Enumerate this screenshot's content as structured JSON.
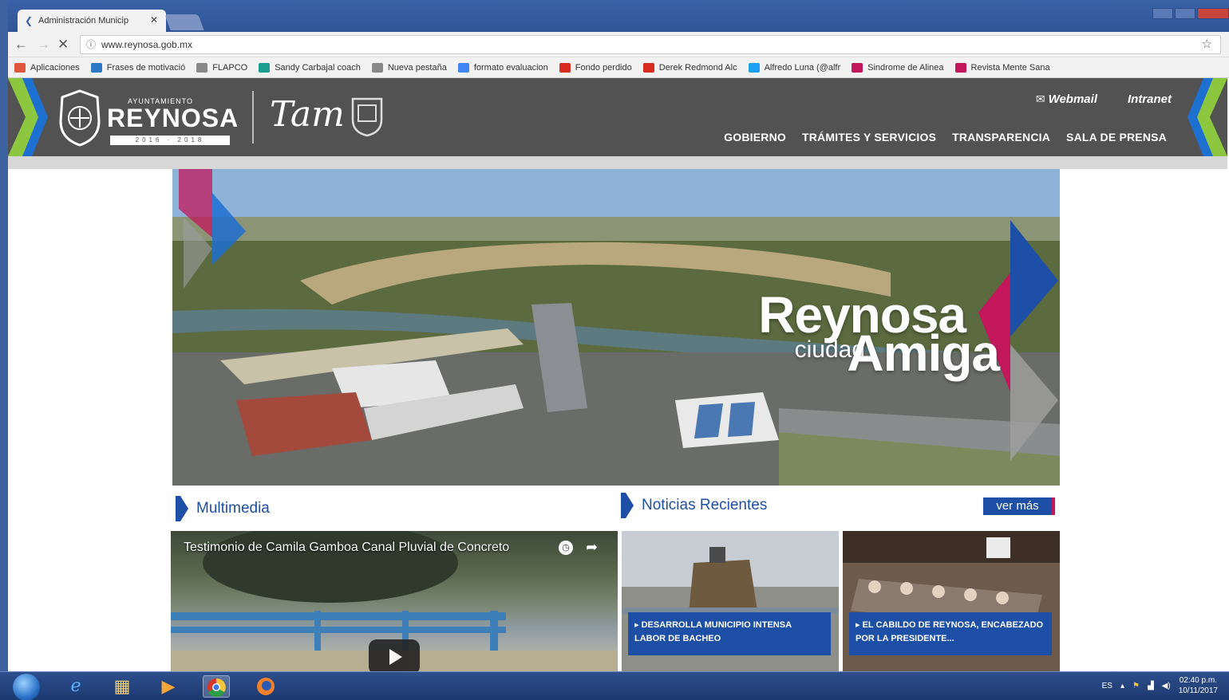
{
  "browser": {
    "tab_title": "Administración Municip",
    "url": "www.reynosa.gob.mx",
    "bookmarks": [
      {
        "label": "Aplicaciones",
        "color": "#e0573f"
      },
      {
        "label": "Frases de motivació",
        "color": "#2b78c5"
      },
      {
        "label": "FLAPCO",
        "color": "#888888"
      },
      {
        "label": "Sandy Carbajal coach",
        "color": "#1a9e8f"
      },
      {
        "label": "Nueva pestaña",
        "color": "#888888"
      },
      {
        "label": "formato evaluacion",
        "color": "#4285f4"
      },
      {
        "label": "Fondo perdido",
        "color": "#d62d20"
      },
      {
        "label": "Derek Redmond Alc",
        "color": "#d62d20"
      },
      {
        "label": "Alfredo Luna (@alfr",
        "color": "#1da1f2"
      },
      {
        "label": "Sindrome de Alinea",
        "color": "#c2185b"
      },
      {
        "label": "Revista Mente Sana",
        "color": "#c2185b"
      }
    ]
  },
  "site": {
    "logo_small": "AYUNTAMIENTO",
    "logo_main": "REYNOSA",
    "logo_years": "2016 · 2018",
    "logo_tam": "Tam",
    "top_links": {
      "webmail": "Webmail",
      "intranet": "Intranet"
    },
    "nav": [
      "GOBIERNO",
      "TRÁMITES Y SERVICIOS",
      "TRANSPARENCIA",
      "SALA DE PRENSA"
    ],
    "hero": {
      "line1": "Reynosa",
      "line2": "ciudad",
      "line3": "Amiga"
    },
    "multimedia": {
      "heading": "Multimedia",
      "video_title": "Testimonio de Camila Gamboa Canal Pluvial de Concreto"
    },
    "news": {
      "heading": "Noticias Recientes",
      "ver_mas": "ver más",
      "items": [
        {
          "caption": "DESARROLLA MUNICIPIO INTENSA LABOR DE BACHEO"
        },
        {
          "caption": "EL CABILDO DE REYNOSA, ENCABEZADO POR LA PRESIDENTE..."
        }
      ]
    }
  },
  "taskbar": {
    "lang": "ES",
    "time": "02:40 p.m.",
    "date": "10/11/2017"
  },
  "colors": {
    "brand_blue": "#1d4fa6",
    "brand_magenta": "#c2185b",
    "brand_green": "#8dc63f",
    "header_grey": "#525252"
  }
}
